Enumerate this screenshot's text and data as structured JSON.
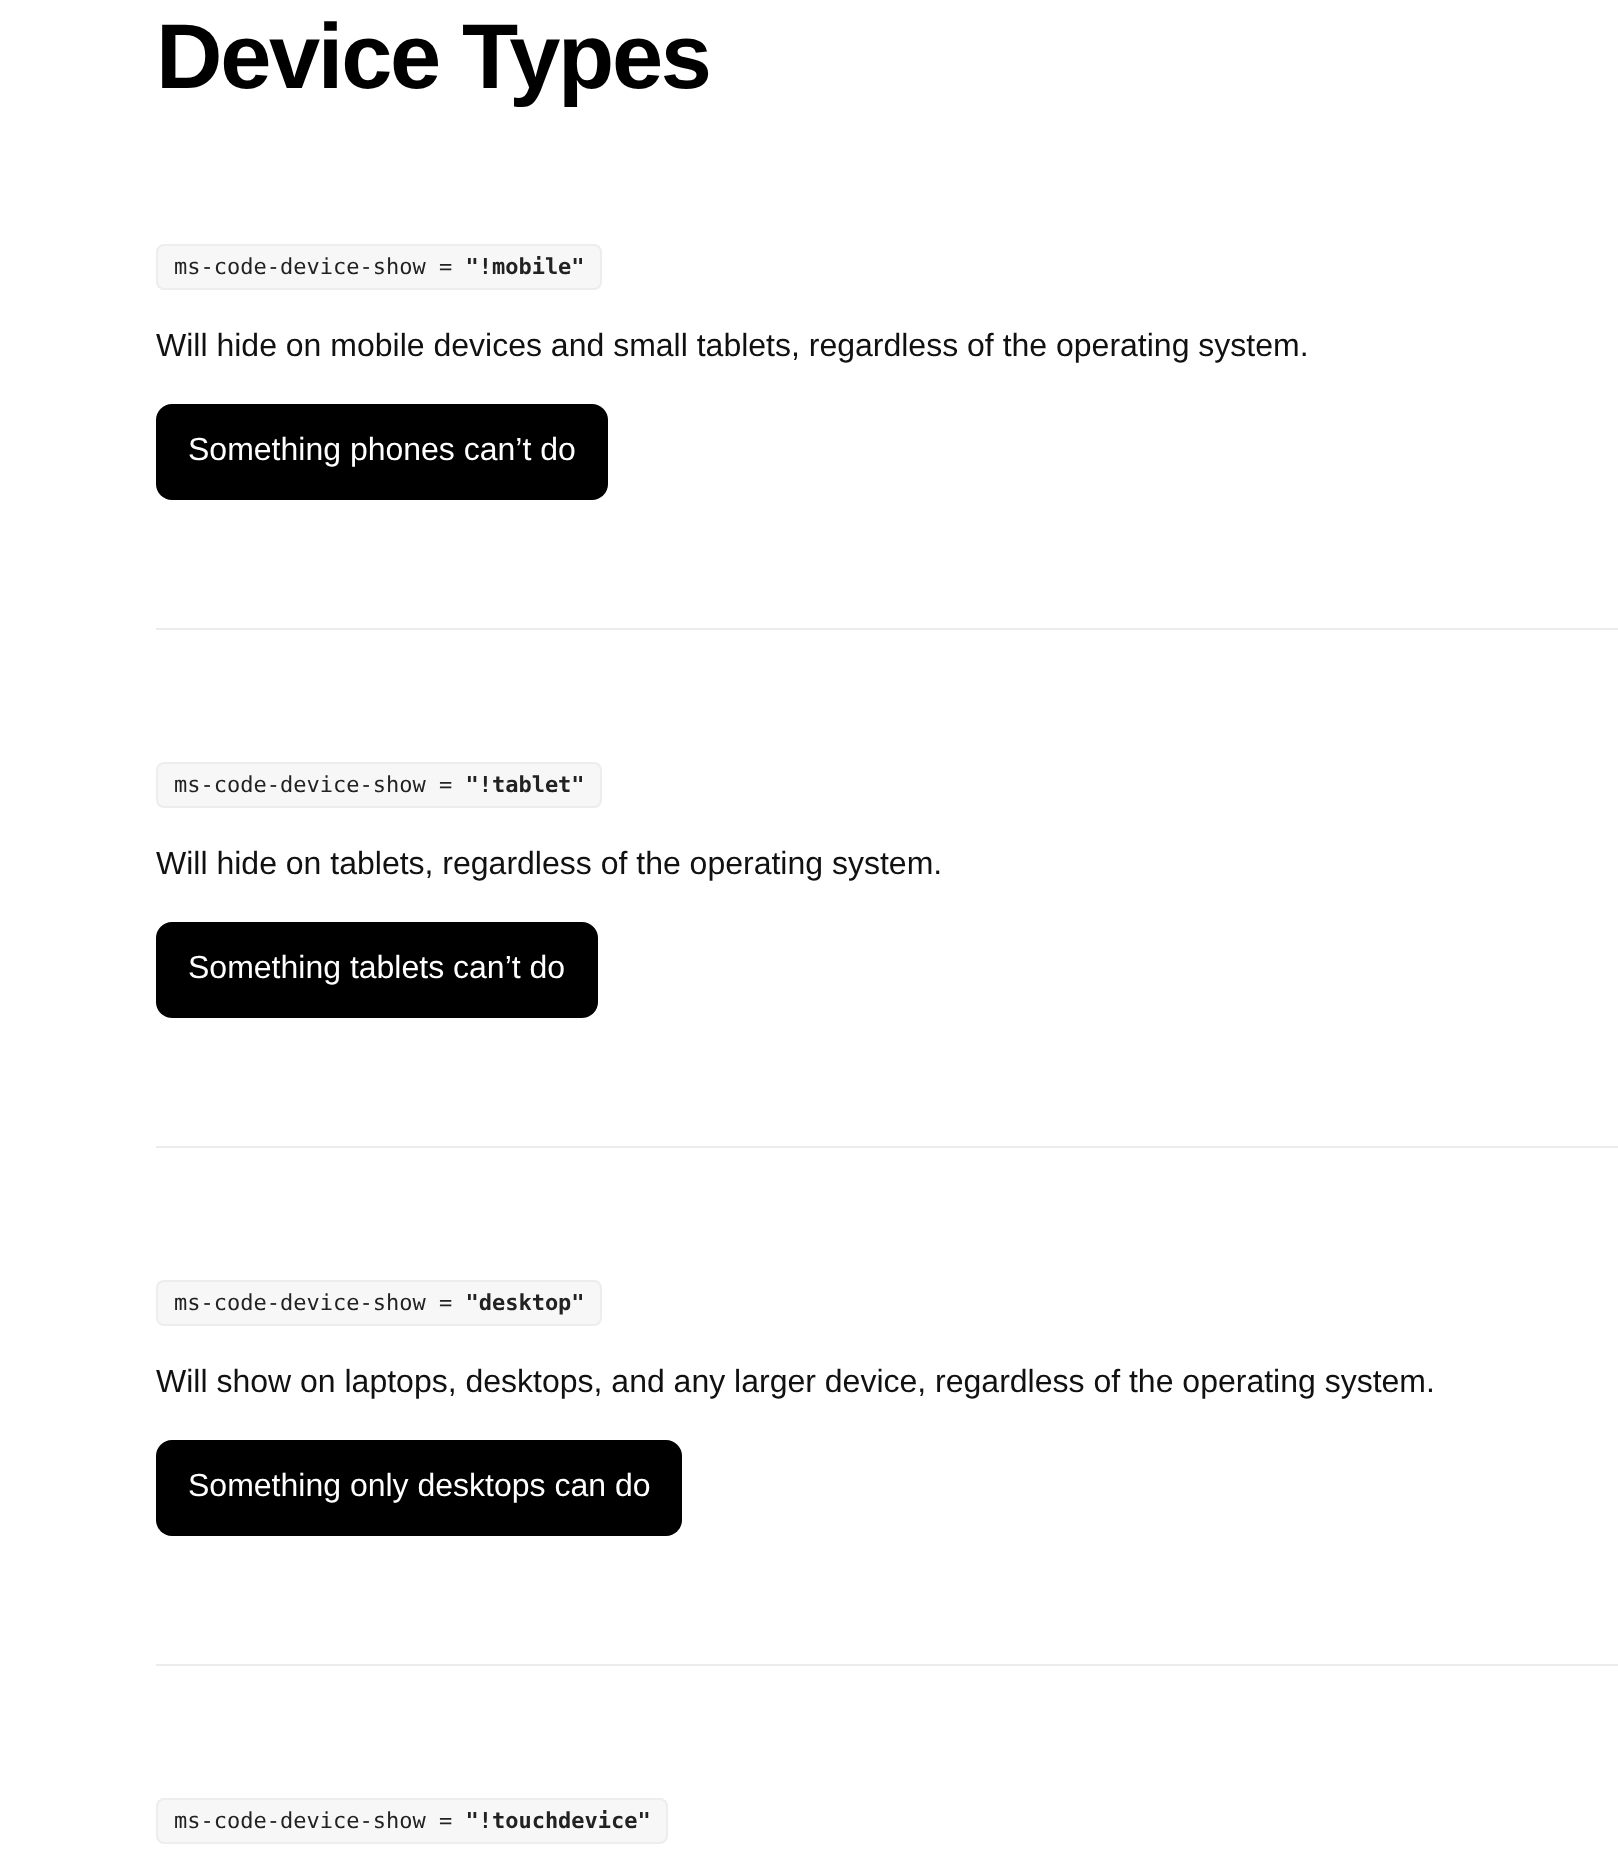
{
  "title": "Device Types",
  "sections": [
    {
      "code": "ms-code-device-show = **\"!mobile\"**",
      "description": "Will hide on mobile devices and small tablets, regardless of the operating system.",
      "button": "Something phones can’t do"
    },
    {
      "code": "ms-code-device-show = **\"!tablet\"**",
      "description": "Will hide on tablets, regardless of the operating system.",
      "button": "Something tablets can’t do"
    },
    {
      "code": "ms-code-device-show = **\"desktop\"**",
      "description": "Will show on laptops, desktops, and any larger device, regardless of the operating system.",
      "button": "Something only desktops can do"
    },
    {
      "code": "ms-code-device-show = **\"!touchdevice\"**"
    }
  ]
}
